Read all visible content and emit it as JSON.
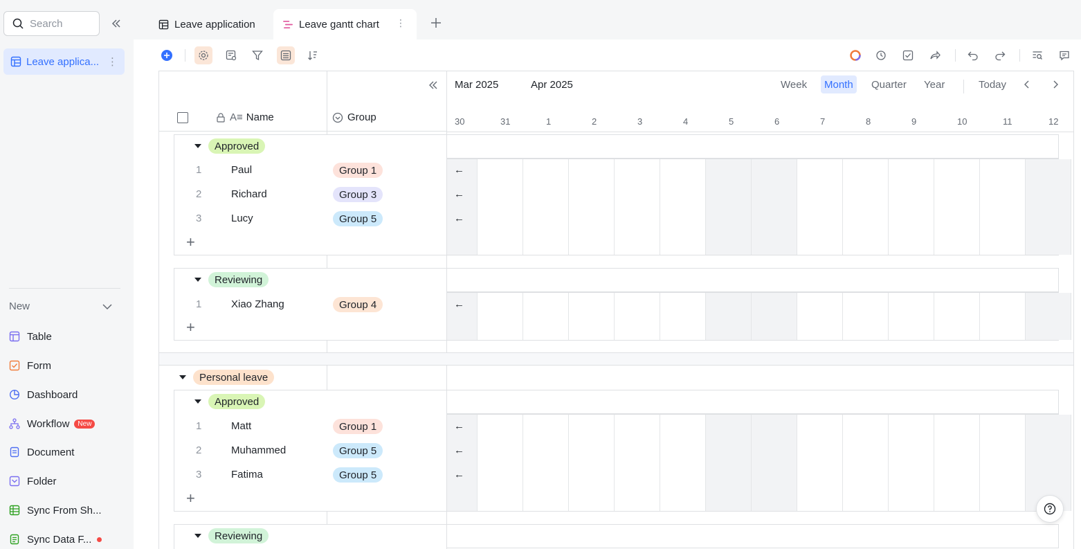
{
  "sidebar": {
    "search_placeholder": "Search",
    "active_item": "Leave applica...",
    "section_label": "New",
    "items": [
      {
        "label": "Table",
        "icon": "table-icon"
      },
      {
        "label": "Form",
        "icon": "form-icon"
      },
      {
        "label": "Dashboard",
        "icon": "dashboard-icon"
      },
      {
        "label": "Workflow",
        "icon": "workflow-icon",
        "badge": "New"
      },
      {
        "label": "Document",
        "icon": "document-icon"
      },
      {
        "label": "Folder",
        "icon": "folder-icon"
      },
      {
        "label": "Sync From Sh...",
        "icon": "sync-sheet-icon"
      },
      {
        "label": "Sync Data F...",
        "icon": "sync-data-icon"
      }
    ]
  },
  "tabs": [
    {
      "label": "Leave application"
    },
    {
      "label": "Leave gantt chart"
    }
  ],
  "grid": {
    "col_name": "Name",
    "col_group": "Group",
    "months": [
      "Mar 2025",
      "Apr 2025"
    ],
    "scales": [
      "Week",
      "Month",
      "Quarter",
      "Year"
    ],
    "today": "Today",
    "days": [
      "30",
      "31",
      "1",
      "2",
      "3",
      "4",
      "5",
      "6",
      "7",
      "8",
      "9",
      "10",
      "11",
      "12"
    ]
  },
  "groups": [
    {
      "status": "Approved",
      "rows": [
        {
          "no": "1",
          "name": "Paul",
          "group": "Group 1"
        },
        {
          "no": "2",
          "name": "Richard",
          "group": "Group 3"
        },
        {
          "no": "3",
          "name": "Lucy",
          "group": "Group 5"
        }
      ]
    },
    {
      "status": "Reviewing",
      "rows": [
        {
          "no": "1",
          "name": "Xiao Zhang",
          "group": "Group 4"
        }
      ]
    },
    {
      "category": "Personal leave",
      "status": "Approved",
      "rows": [
        {
          "no": "1",
          "name": "Matt",
          "group": "Group 1"
        },
        {
          "no": "2",
          "name": "Muhammed",
          "group": "Group 5"
        },
        {
          "no": "3",
          "name": "Fatima",
          "group": "Group 5"
        }
      ]
    },
    {
      "status": "Reviewing",
      "rows": []
    }
  ],
  "colors": {
    "accent": "#3370ff",
    "approved_tag": "#d9f5b5",
    "reviewing_tag": "#d1f3d8",
    "personal_tag": "#fde2cc",
    "group1": "#fde2db",
    "group3": "#e4e4fb",
    "group4": "#fde5d4",
    "group5": "#cce9fb"
  }
}
